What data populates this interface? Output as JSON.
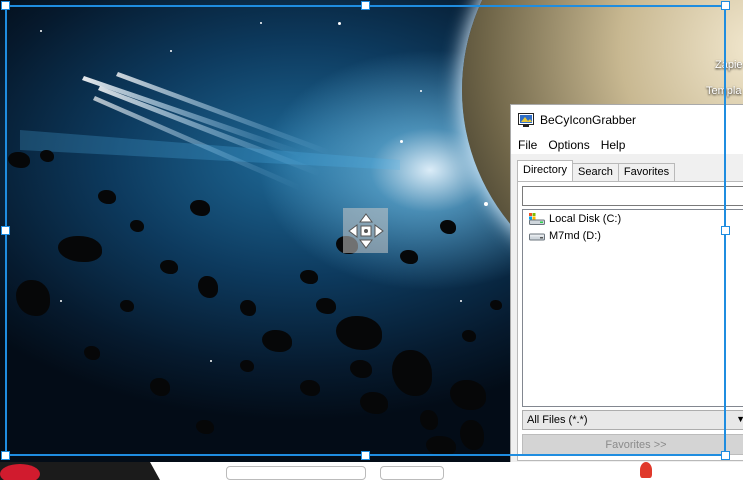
{
  "desktop": {
    "icon_label_line1": "Zapie",
    "icon_label_line2": "Templa"
  },
  "app": {
    "title": "BeCyIconGrabber",
    "menu": [
      "File",
      "Options",
      "Help"
    ],
    "tabs": [
      {
        "label": "Directory",
        "active": true
      },
      {
        "label": "Search",
        "active": false
      },
      {
        "label": "Favorites",
        "active": false
      }
    ],
    "path_value": "",
    "drives": [
      {
        "label": "Local Disk (C:)",
        "icon": "system-drive-icon"
      },
      {
        "label": "M7md (D:)",
        "icon": "drive-icon"
      }
    ],
    "filter_value": "All Files (*.*)",
    "favorites_button": "Favorites >>"
  },
  "colors": {
    "selection_border": "#1f8de0",
    "window_bg": "#f0f0f0"
  }
}
